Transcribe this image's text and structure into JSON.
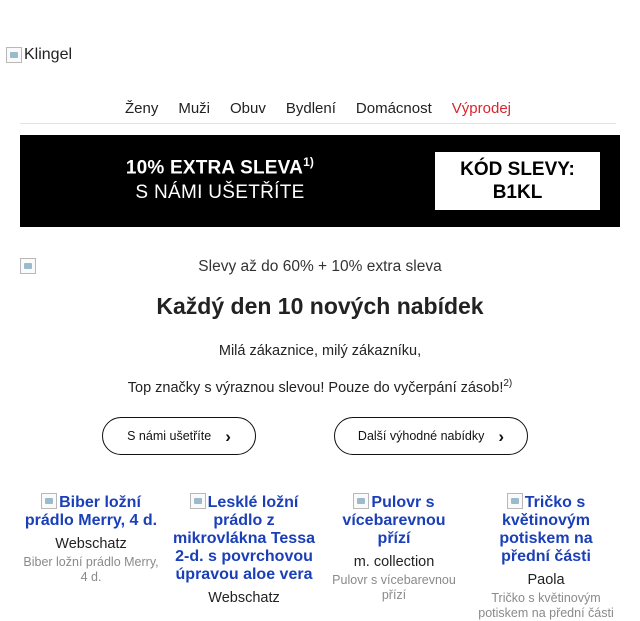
{
  "logo": {
    "alt": "Klingel"
  },
  "nav": {
    "items": [
      {
        "label": "Ženy"
      },
      {
        "label": "Muži"
      },
      {
        "label": "Obuv"
      },
      {
        "label": "Bydlení"
      },
      {
        "label": "Domácnost"
      },
      {
        "label": "Výprodej",
        "color": "#d8252f"
      }
    ]
  },
  "promo": {
    "line1": "10% EXTRA SLEVA",
    "footnote": "1)",
    "line2": "S NÁMI UŠETŘÍTE",
    "code_label": "KÓD SLEVY:",
    "code": "B1KL"
  },
  "hero": {
    "alt": "Slevy až do 60% + 10% extra sleva",
    "headline": "Každý den 10 nových nabídek",
    "greeting": "Milá zákaznice, milý zákazníku,",
    "tagline": "Top značky s výraznou slevou! Pouze do vyčerpání zásob!",
    "tagline_footnote": "2)"
  },
  "buttons": [
    {
      "label": "S námi ušetříte"
    },
    {
      "label": "Další výhodné nabídky"
    }
  ],
  "products": [
    {
      "title": "Biber ložní prádlo Merry, 4 d.",
      "brand": "Webschatz",
      "desc": "Biber ložní prádlo Merry, 4 d."
    },
    {
      "title": "Lesklé ložní prádlo z mikrovlákna Tessa 2-d. s povrchovou úpravou aloe vera",
      "brand": "Webschatz",
      "desc": ""
    },
    {
      "title": "Pulovr s vícebarevnou přízí",
      "brand": "m. collection",
      "desc": "Pulovr s vícebarevnou přízí"
    },
    {
      "title": "Tričko s květinovým potiskem na přední části",
      "brand": "Paola",
      "desc": "Tričko s květinovým potiskem na přední části"
    }
  ]
}
